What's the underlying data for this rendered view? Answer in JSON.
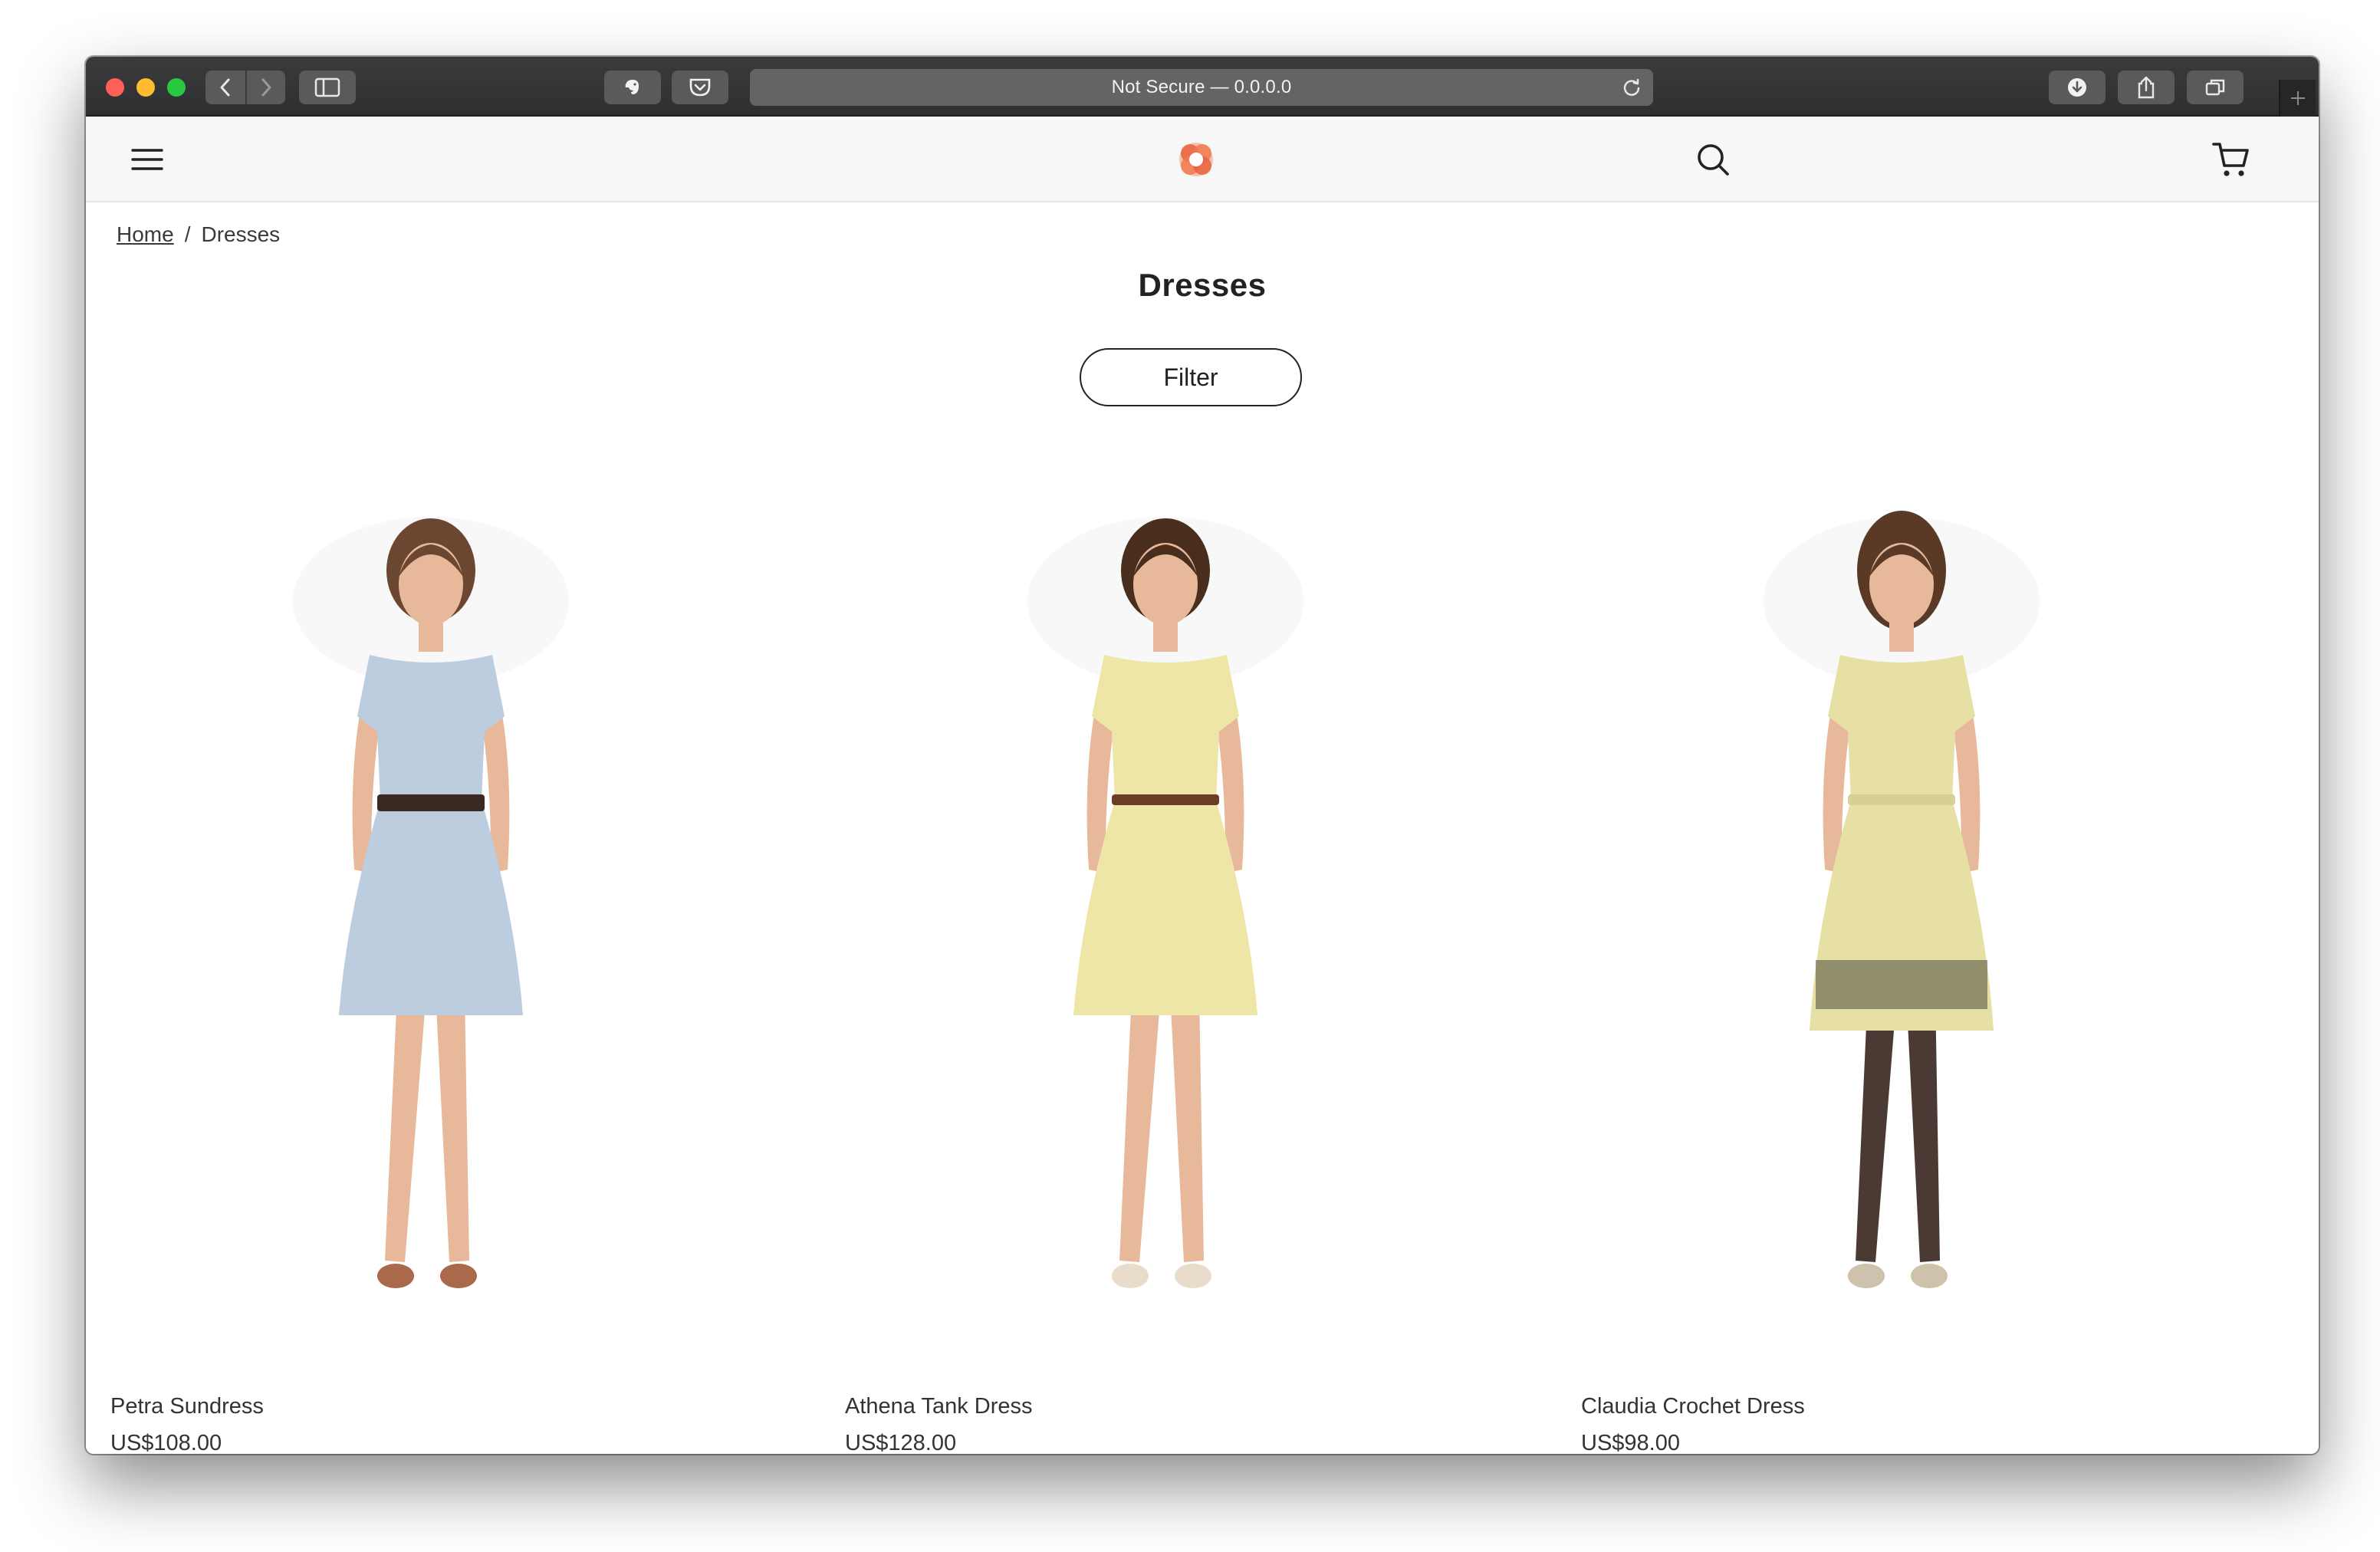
{
  "browser": {
    "url_text": "Not Secure — 0.0.0.0"
  },
  "breadcrumb": {
    "home": "Home",
    "separator": "/",
    "current": "Dresses"
  },
  "page": {
    "title": "Dresses",
    "filter_label": "Filter"
  },
  "brand": {
    "logo_color": "#e8633a"
  },
  "products": [
    {
      "name": "Petra Sundress",
      "price": "US$108.00",
      "dress_color": "#bccde0",
      "belt_color": "#3b2a24",
      "legs": "bare",
      "shoe_color": "#a86a4a"
    },
    {
      "name": "Athena Tank Dress",
      "price": "US$128.00",
      "dress_color": "#ede6a6",
      "belt_color": "#6b3d22",
      "legs": "bare",
      "shoe_color": "#e9dccb"
    },
    {
      "name": "Claudia Crochet Dress",
      "price": "US$98.00",
      "dress_color": "#e6e0a4",
      "belt_color": "#d8d092",
      "legs": "leggings",
      "shoe_color": "#cfc2ad"
    }
  ]
}
